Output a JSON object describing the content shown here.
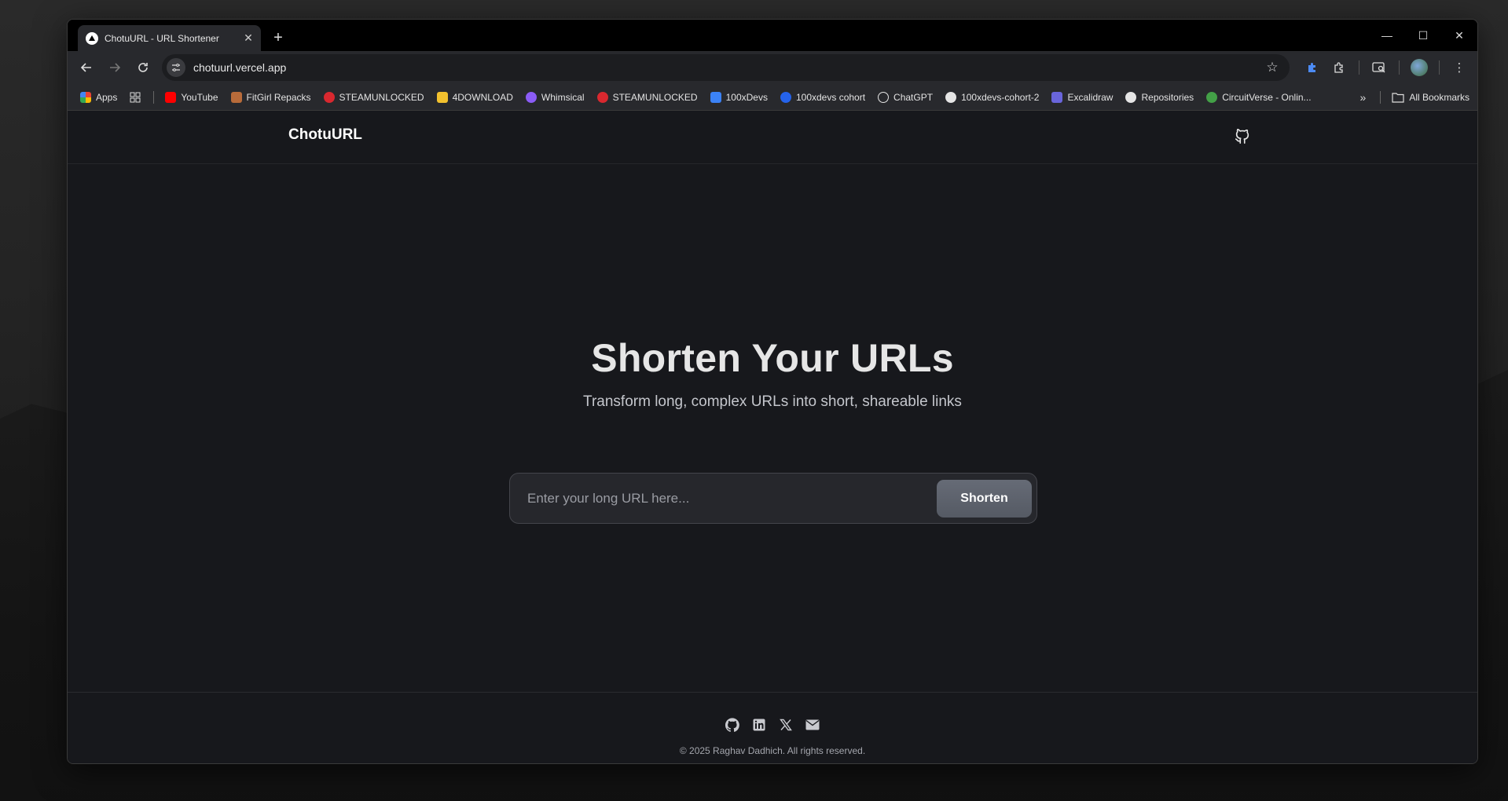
{
  "browser": {
    "tab_title": "ChotuURL - URL Shortener",
    "tab_close": "✕",
    "new_tab": "+",
    "window_controls": {
      "minimize": "—",
      "maximize": "☐",
      "close": "✕"
    },
    "url": "chotuurl.vercel.app",
    "bookmarks": [
      {
        "label": "Apps",
        "color": "#4285f4"
      },
      {
        "label": "YouTube",
        "color": "#ff0000"
      },
      {
        "label": "FitGirl Repacks",
        "color": "#b86b3a"
      },
      {
        "label": "STEAMUNLOCKED",
        "color": "#d9282f"
      },
      {
        "label": "4DOWNLOAD",
        "color": "#f2c12e"
      },
      {
        "label": "Whimsical",
        "color": "#8b5cf6"
      },
      {
        "label": "STEAMUNLOCKED",
        "color": "#d9282f"
      },
      {
        "label": "100xDevs",
        "color": "#3b82f6"
      },
      {
        "label": "100xdevs cohort",
        "color": "#2563eb"
      },
      {
        "label": "ChatGPT",
        "color": "#e5e5e5"
      },
      {
        "label": "100xdevs-cohort-2",
        "color": "#e5e5e5"
      },
      {
        "label": "Excalidraw",
        "color": "#6965db"
      },
      {
        "label": "Repositories",
        "color": "#e5e5e5"
      },
      {
        "label": "CircuitVerse - Onlin...",
        "color": "#43a047"
      }
    ],
    "more_bookmarks": "»",
    "all_bookmarks": "All Bookmarks"
  },
  "site": {
    "logo": "ChotuURL",
    "hero": {
      "title": "Shorten Your URLs",
      "subtitle": "Transform long, complex URLs into short, shareable links"
    },
    "form": {
      "placeholder": "Enter your long URL here...",
      "button": "Shorten"
    },
    "footer": {
      "copyright": "© 2025 Raghav Dadhich. All rights reserved.",
      "socials": [
        "github-icon",
        "linkedin-icon",
        "x-icon",
        "mail-icon"
      ]
    }
  }
}
